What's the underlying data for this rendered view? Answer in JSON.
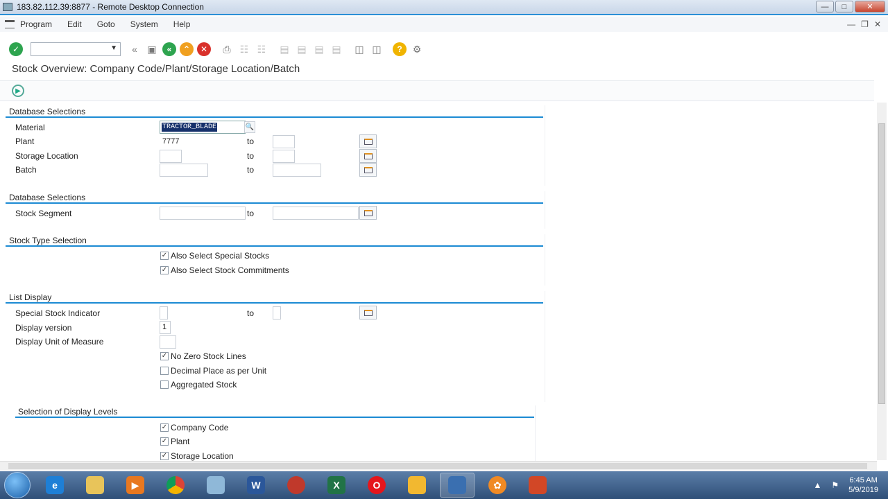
{
  "window": {
    "title": "183.82.112.39:8877 - Remote Desktop Connection"
  },
  "menu": [
    "Program",
    "Edit",
    "Goto",
    "System",
    "Help"
  ],
  "page_title": "Stock Overview: Company Code/Plant/Storage Location/Batch",
  "sections": {
    "db1": {
      "title": "Database Selections",
      "material_label": "Material",
      "material_value": "TRACTOR_BLADE",
      "plant_label": "Plant",
      "plant_value": "7777",
      "storage_label": "Storage Location",
      "batch_label": "Batch"
    },
    "db2": {
      "title": "Database Selections",
      "segment_label": "Stock Segment"
    },
    "stock_type": {
      "title": "Stock Type Selection",
      "special_stocks": "Also Select Special Stocks",
      "commitments": "Also Select Stock Commitments"
    },
    "list_display": {
      "title": "List Display",
      "special_ind_label": "Special Stock Indicator",
      "display_version_label": "Display version",
      "display_version_value": "1",
      "uom_label": "Display Unit of Measure",
      "no_zero": "No Zero Stock Lines",
      "decimal": "Decimal Place as per Unit",
      "aggregated": "Aggregated Stock"
    },
    "levels": {
      "title": "Selection of Display Levels",
      "company_code": "Company Code",
      "plant": "Plant",
      "storage_location": "Storage Location"
    }
  },
  "to_label": "to",
  "checkbox_mark": "✓",
  "clock": {
    "time": "6:45 AM",
    "date": "5/9/2019"
  }
}
